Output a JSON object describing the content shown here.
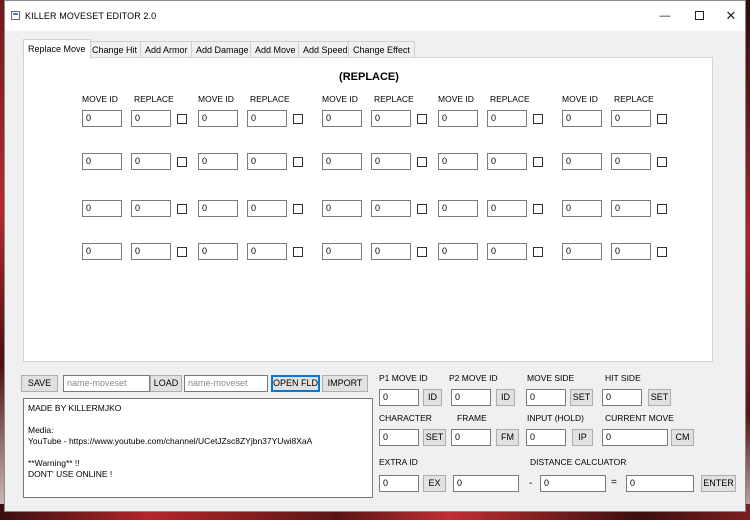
{
  "window": {
    "title": "KILLER MOVESET EDITOR 2.0",
    "min_glyph": "—",
    "close_glyph": "✕"
  },
  "tabs": [
    {
      "label": "Replace Move",
      "active": true
    },
    {
      "label": "Change Hit"
    },
    {
      "label": "Add Armor"
    },
    {
      "label": "Add Damage"
    },
    {
      "label": "Add Move"
    },
    {
      "label": "Add Speed"
    },
    {
      "label": "Change Effect"
    }
  ],
  "replace": {
    "heading": "(REPLACE)",
    "col_move_id": "MOVE ID",
    "col_replace": "REPLACE",
    "default_value": "0"
  },
  "bottom": {
    "save": "SAVE",
    "name1_placeholder": "name-moveset",
    "load": "LOAD",
    "name2_placeholder": "name-moveset",
    "open_fld": "OPEN FLD",
    "import": "IMPORT",
    "log_lines": [
      "MADE BY KILLERMJKO",
      "",
      "Media:",
      "YouTube - https://www.youtube.com/channel/UCetJZsc8ZYjbn37YUwi8XaA",
      "",
      "**Warning** !!",
      "DONT' USE ONLINE !"
    ],
    "p1_label": "P1 MOVE ID",
    "p1_value": "0",
    "p1_btn": "ID",
    "p2_label": "P2 MOVE ID",
    "p2_value": "0",
    "p2_btn": "ID",
    "side_label": "MOVE SIDE",
    "side_value": "0",
    "side_btn": "SET",
    "hit_label": "HIT SIDE",
    "hit_value": "0",
    "hit_btn": "SET",
    "char_label": "CHARACTER",
    "char_value": "0",
    "char_btn": "SET",
    "frame_label": "FRAME",
    "frame_value": "0",
    "frame_btn": "FM",
    "input_label": "INPUT (HOLD)",
    "input_value": "0",
    "input_btn": "IP",
    "cur_label": "CURRENT MOVE",
    "cur_value": "0",
    "cur_btn": "CM",
    "extra_label": "EXTRA ID",
    "extra_value": "0",
    "extra_btn": "EX",
    "extra_value2": "0",
    "dist_label": "DISTANCE CALCUATOR",
    "dist_value1": "0",
    "minus": "-",
    "equals": "=",
    "dist_value2": "0",
    "enter": "ENTER"
  }
}
